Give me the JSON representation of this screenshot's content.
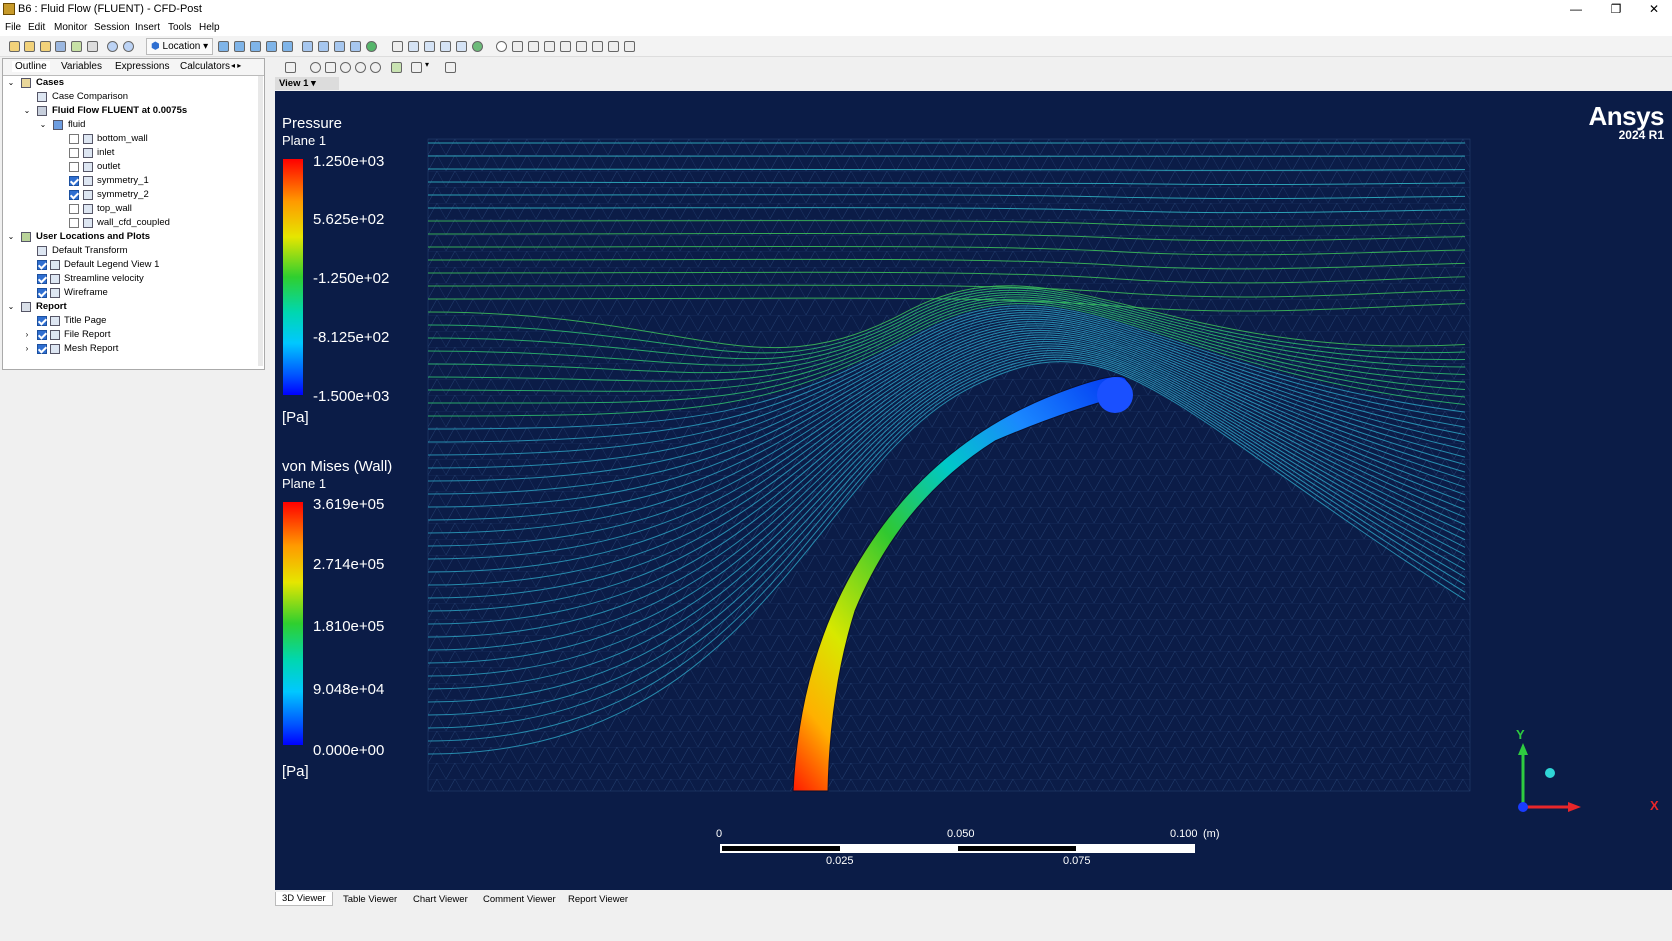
{
  "window": {
    "title": "B6 : Fluid Flow (FLUENT) - CFD-Post",
    "controls": [
      "—",
      "❐",
      "✕"
    ]
  },
  "menu": [
    "File",
    "Edit",
    "Monitor",
    "Session",
    "Insert",
    "Tools",
    "Help"
  ],
  "toolbar": {
    "location_label": "Location"
  },
  "panel": {
    "tabs": [
      "Outline",
      "Variables",
      "Expressions",
      "Calculators"
    ],
    "tree": {
      "cases": "Cases",
      "case_comparison": "Case Comparison",
      "case_name": "Fluid Flow FLUENT at 0.0075s",
      "domain": "fluid",
      "boundaries": [
        {
          "label": "bottom_wall",
          "checked": false
        },
        {
          "label": "inlet",
          "checked": false
        },
        {
          "label": "outlet",
          "checked": false
        },
        {
          "label": "symmetry_1",
          "checked": true
        },
        {
          "label": "symmetry_2",
          "checked": true
        },
        {
          "label": "top_wall",
          "checked": false
        },
        {
          "label": "wall_cfd_coupled",
          "checked": false
        }
      ],
      "user_locations": "User Locations and Plots",
      "user_items": [
        {
          "label": "Default Transform",
          "checked": null
        },
        {
          "label": "Default Legend View 1",
          "checked": true
        },
        {
          "label": "Streamline velocity",
          "checked": true
        },
        {
          "label": "Wireframe",
          "checked": true
        }
      ],
      "report": "Report",
      "report_items": [
        {
          "label": "Title Page",
          "checked": true
        },
        {
          "label": "File Report",
          "checked": true
        },
        {
          "label": "Mesh Report",
          "checked": true
        }
      ]
    }
  },
  "viewer": {
    "tab_label": "View 1",
    "brand": "Ansys",
    "version": "2024 R1",
    "legend_pressure": {
      "title": "Pressure",
      "location": "Plane 1",
      "values": [
        "1.250e+03",
        "5.625e+02",
        "-1.250e+02",
        "-8.125e+02",
        "-1.500e+03"
      ],
      "unit": "[Pa]"
    },
    "legend_vonmises": {
      "title": "von Mises (Wall)",
      "location": "Plane 1",
      "values": [
        "3.619e+05",
        "2.714e+05",
        "1.810e+05",
        "9.048e+04",
        "0.000e+00"
      ],
      "unit": "[Pa]"
    },
    "scale": {
      "top": [
        "0",
        "0.050",
        "0.100"
      ],
      "unit": "(m)",
      "bottom": [
        "0.025",
        "0.075"
      ]
    },
    "axes": {
      "y": "Y",
      "x": "X"
    },
    "colors": {
      "background": "#0b1c47",
      "axis_y": "#2ecc40",
      "axis_x": "#e8262a",
      "axis_z": "#2fd6d6"
    }
  },
  "bottom_tabs": [
    "3D Viewer",
    "Table Viewer",
    "Chart Viewer",
    "Comment Viewer",
    "Report Viewer"
  ]
}
